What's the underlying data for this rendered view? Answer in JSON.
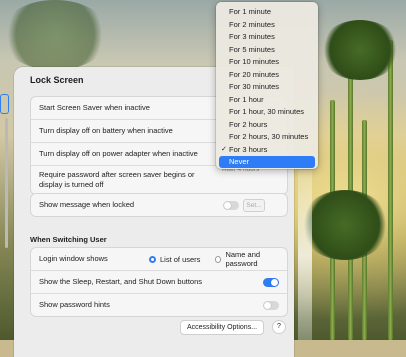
{
  "panel": {
    "title": "Lock Screen"
  },
  "settings": {
    "rows": [
      {
        "label": "Start Screen Saver when inactive"
      },
      {
        "label": "Turn display off on battery when inactive"
      },
      {
        "label": "Turn display off on power adapter when inactive"
      },
      {
        "label": "Require password after screen saver begins or display is turned off"
      }
    ],
    "require_value_partial": "After 4 hours"
  },
  "message": {
    "label": "Show message when locked",
    "toggle_on": false,
    "set_button": "Set..."
  },
  "switching": {
    "section_title": "When Switching User",
    "login_label": "Login window shows",
    "option_list": "List of users",
    "option_name": "Name and password",
    "selected_option": "List of users",
    "sleep_label": "Show the Sleep, Restart, and Shut Down buttons",
    "sleep_toggle_on": true,
    "hints_label": "Show password hints",
    "hints_toggle_on": false
  },
  "footer": {
    "accessibility_button": "Accessibility Options...",
    "help_button": "?"
  },
  "dropdown": {
    "items": [
      {
        "label": "For 1 minute",
        "checked": false,
        "selected": false
      },
      {
        "label": "For 2 minutes",
        "checked": false,
        "selected": false
      },
      {
        "label": "For 3 minutes",
        "checked": false,
        "selected": false
      },
      {
        "label": "For 5 minutes",
        "checked": false,
        "selected": false
      },
      {
        "label": "For 10 minutes",
        "checked": false,
        "selected": false
      },
      {
        "label": "For 20 minutes",
        "checked": false,
        "selected": false
      },
      {
        "label": "For 30 minutes",
        "checked": false,
        "selected": false
      },
      {
        "label": "For 1 hour",
        "checked": false,
        "selected": false
      },
      {
        "label": "For 1 hour, 30 minutes",
        "checked": false,
        "selected": false
      },
      {
        "label": "For 2 hours",
        "checked": false,
        "selected": false
      },
      {
        "label": "For 2 hours, 30 minutes",
        "checked": false,
        "selected": false
      },
      {
        "label": "For 3 hours",
        "checked": true,
        "selected": false
      },
      {
        "label": "Never",
        "checked": false,
        "selected": true
      }
    ],
    "check_glyph": "✓"
  },
  "colors": {
    "accent": "#2f7df6"
  }
}
